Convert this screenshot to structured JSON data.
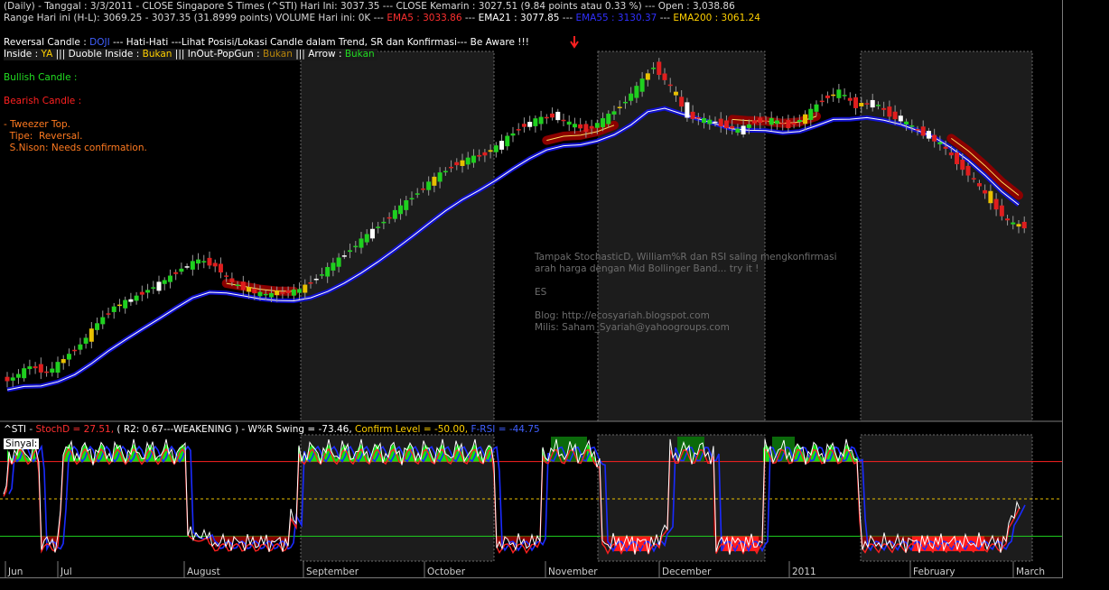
{
  "header": {
    "line1": {
      "period": "(Daily)",
      "date": "Tanggal : 3/3/2011",
      "close": "CLOSE Singapore S Times  (^STI) Hari Ini: 3037.35 --- CLOSE Kemarin :  3027.51 (9.84 points atau 0.33 %) --- Open : 3,038.86"
    },
    "line2": {
      "range": "Range Hari ini (H-L):  3069.25 - 3037.35 (31.8999 points) VOLUME Hari ini:  0K --- ",
      "ema5": "EMA5 : 3033.86",
      "sep1": " --- ",
      "ema21": "EMA21 : 3077.85",
      "sep2": " --- ",
      "ema55": "EMA55 : 3130.37",
      "sep3": " --- ",
      "ema200": "EMA200 : 3061.24"
    }
  },
  "candle_info": {
    "reversal_label": "Reversal Candle : ",
    "reversal_value": "DOJI",
    "warning": "  --- Hati-Hati ---Lihat Posisi/Lokasi Candle dalam Trend, SR dan Konfirmasi--- Be Aware !!!",
    "inside_label": "Inside : ",
    "inside_value": "YA",
    "sep": " ||| ",
    "duoble_label": "Duoble Inside : ",
    "duoble_value": "Bukan",
    "inout_label": "InOut-PopGun : ",
    "inout_value": "Bukan",
    "arrow_label": "Arrow : ",
    "arrow_value": "Bukan",
    "bullish": "Bullish Candle :",
    "bearish": "Bearish Candle :",
    "tweezer": "- Tweezer Top.",
    "tipe": "  Tipe:  Reversal.",
    "snison": "  S.Nison: Needs confirmation."
  },
  "watermark": {
    "line1": "Tampak StochasticD, William%R dan RSI saling mengkonfirmasi",
    "line2": "arah harga dengan Mid Bollinger Band... try it !",
    "line3": "ES",
    "line4": "Blog:  http://ecosyariah.blogspot.com",
    "line5": "Milis: Saham_Syariah@yahoogroups.com"
  },
  "indicator": {
    "symbol": "^STI",
    "stoch": "StochD = 27.51,",
    "r2": "  ( R2: 0.67---WEAKENING )",
    "wr": " - W%R Swing = -73.46,",
    "confirm": " Confirm Level = -50.00,",
    "frsi": " F-RSI = -44.75",
    "sinyal": "Sinyal:"
  },
  "colors": {
    "up_candle": "#1fd01f",
    "down_candle": "#e01e1e",
    "doji_candle": "#ffffff",
    "caution_candle": "#e8c000",
    "ema_blue": "#1212cc",
    "band_red": "#8c0000",
    "zone_fill": "#1c1c1c",
    "ema5_text": "#ff3030",
    "ema55_text": "#3030ff",
    "ema200_text": "#ffd000",
    "stoch_text": "#ff3030",
    "frsi_text": "#4060ff"
  },
  "chart_data": {
    "type": "candlestick",
    "symbol": "^STI",
    "x_labels": [
      "Jun",
      "Jul",
      "August",
      "September",
      "October",
      "November",
      "December",
      "2011",
      "February",
      "March"
    ],
    "price_closes_estimated": [
      2720,
      2745,
      2730,
      2760,
      2790,
      2835,
      2870,
      2885,
      2905,
      2925,
      2950,
      2968,
      2955,
      2920,
      2902,
      2895,
      2898,
      2905,
      2930,
      2960,
      2990,
      3020,
      3050,
      3080,
      3110,
      3140,
      3165,
      3180,
      3190,
      3215,
      3245,
      3262,
      3270,
      3255,
      3240,
      3262,
      3290,
      3330,
      3375,
      3330,
      3270,
      3262,
      3252,
      3240,
      3258,
      3262,
      3248,
      3270,
      3305,
      3322,
      3290,
      3300,
      3272,
      3255,
      3232,
      3212,
      3172,
      3135,
      3090,
      3048,
      3037
    ],
    "stoch_d_last": 27.51,
    "r2": 0.67,
    "wr_swing": -73.46,
    "confirm_level": -50.0,
    "f_rsi": -44.75,
    "grid": false
  }
}
